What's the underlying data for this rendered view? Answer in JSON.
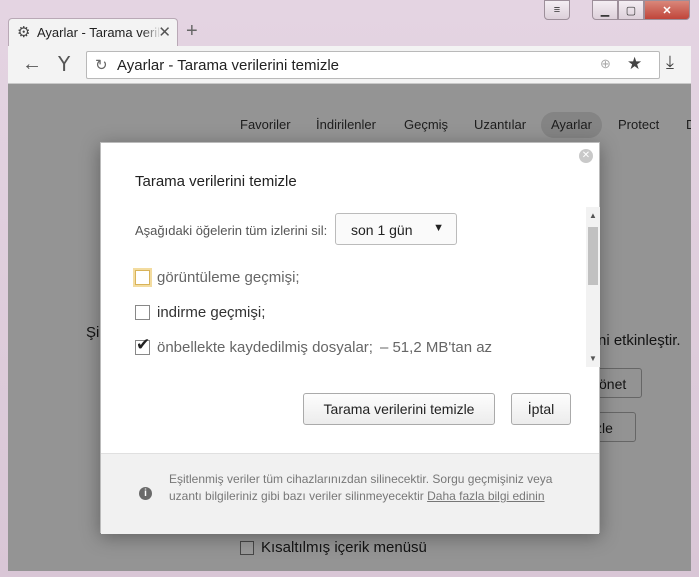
{
  "tab": {
    "title": "Ayarlar - Tarama verilerini temizle",
    "close": "✕",
    "newtab": "+"
  },
  "window_buttons": {
    "menu": "≡",
    "minimize": "▁",
    "maximize": "▢",
    "close": "✕"
  },
  "toolbar": {
    "url": "Ayarlar - Tarama verilerini temizle"
  },
  "nav": {
    "items": [
      "Favoriler",
      "İndirilenler",
      "Geçmiş",
      "Uzantılar",
      "Ayarlar",
      "Protect",
      "D"
    ],
    "active": "Ayarlar"
  },
  "background": {
    "left_text": "Şi",
    "right_text": "ni etkinleştir.",
    "button1": "önet",
    "button2": "zle",
    "checkbox_label": "Kısaltılmış içerik menüsü"
  },
  "dialog": {
    "title": "Tarama verilerini temizle",
    "prompt": "Aşağıdaki öğelerin tüm izlerini sil:",
    "select_value": "son 1 gün",
    "options": [
      {
        "label": "görüntüleme geçmişi;",
        "checked": false
      },
      {
        "label": "indirme geçmişi;",
        "checked": false
      },
      {
        "label": "önbellekte kaydedilmiş dosyalar;",
        "extra": "– 51,2 MB'tan az",
        "checked": true
      }
    ],
    "clear_button": "Tarama verilerini temizle",
    "cancel_button": "İptal",
    "footer_text": "Eşitlenmiş veriler tüm cihazlarınızdan silinecektir. Sorgu geçmişiniz veya uzantı bilgileriniz gibi bazı veriler silinmeyecektir ",
    "footer_link": "Daha fazla bilgi edinin"
  }
}
